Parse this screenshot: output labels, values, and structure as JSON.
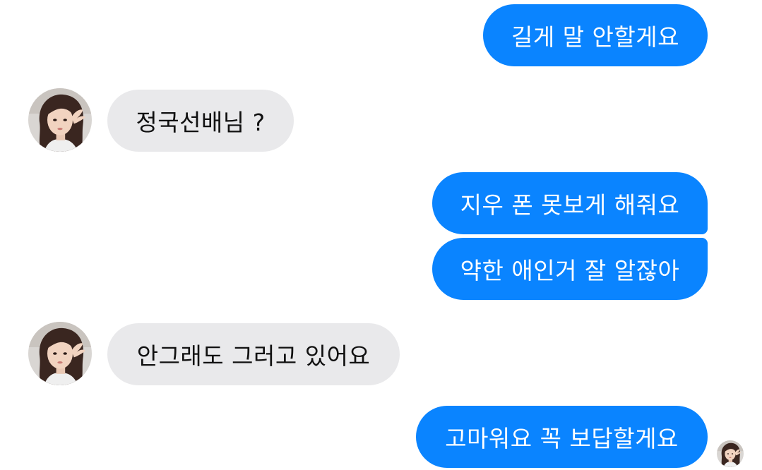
{
  "chat": {
    "messages": [
      {
        "direction": "sent",
        "text": "길게 말 안할게요"
      },
      {
        "direction": "received",
        "text": "정국선배님 ?"
      },
      {
        "direction": "sent",
        "text": "지우 폰 못보게 해줘요"
      },
      {
        "direction": "sent",
        "text": "약한 애인거 잘 알잖아"
      },
      {
        "direction": "received",
        "text": "안그래도 그러고 있어요"
      },
      {
        "direction": "sent",
        "text": "고마워요 꼭 보답할게요"
      }
    ],
    "contact_avatar_icon": "girl-portrait-avatar-icon",
    "read_receipt_icon": "read-receipt-avatar-icon"
  },
  "colors": {
    "sent_bubble": "#0a84ff",
    "sent_text": "#ffffff",
    "received_bubble": "#e9e9eb",
    "received_text": "#111111",
    "background": "#ffffff"
  }
}
